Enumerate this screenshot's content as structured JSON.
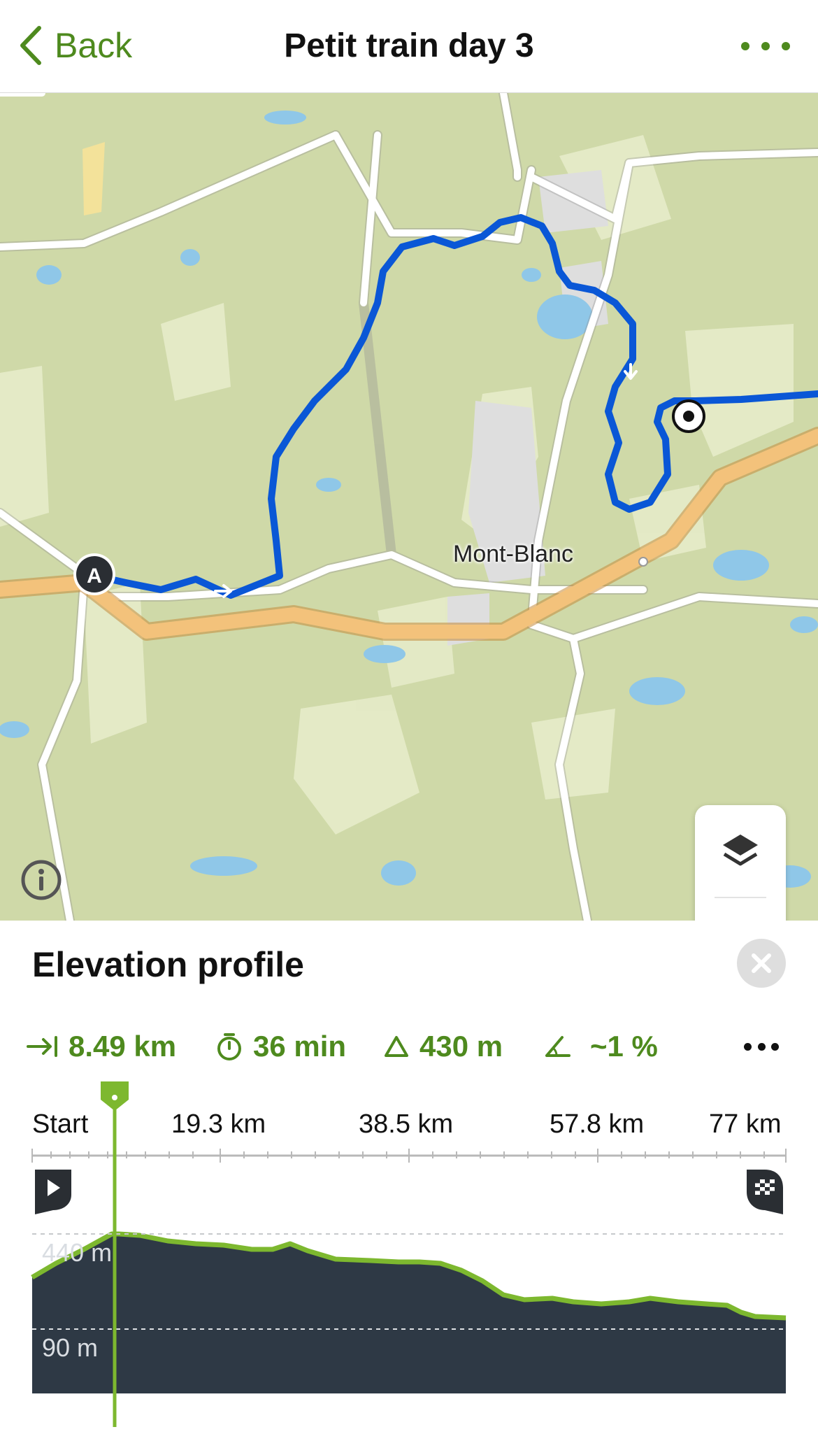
{
  "header": {
    "back_label": "Back",
    "title": "Petit train day 3"
  },
  "map": {
    "place_label": "Mont-Blanc",
    "start_marker": "A",
    "colors": {
      "land": "#cfd9a8",
      "route": "#0a57d6",
      "highway": "#f3c27b",
      "water": "#8fc7e8"
    }
  },
  "panel": {
    "title": "Elevation profile",
    "stats": {
      "distance": "8.49 km",
      "duration": "36 min",
      "ascent": "430 m",
      "grade": "~1 %"
    },
    "axis_ticks": [
      "Start",
      "19.3 km",
      "38.5 km",
      "57.8 km",
      "77 km"
    ],
    "elevation_labels": [
      "440 m",
      "90 m"
    ]
  },
  "icons": {
    "back": "chevron-left-icon",
    "more": "ellipsis-icon",
    "info": "info-icon",
    "layers": "layers-icon",
    "locate": "location-arrow-icon",
    "close": "close-icon",
    "distance": "distance-arrow-icon",
    "duration": "stopwatch-icon",
    "ascent": "triangle-icon",
    "grade": "slope-icon",
    "start": "play-flag-icon",
    "finish": "checkered-flag-icon"
  },
  "accent_color": "#4e8a1e"
}
